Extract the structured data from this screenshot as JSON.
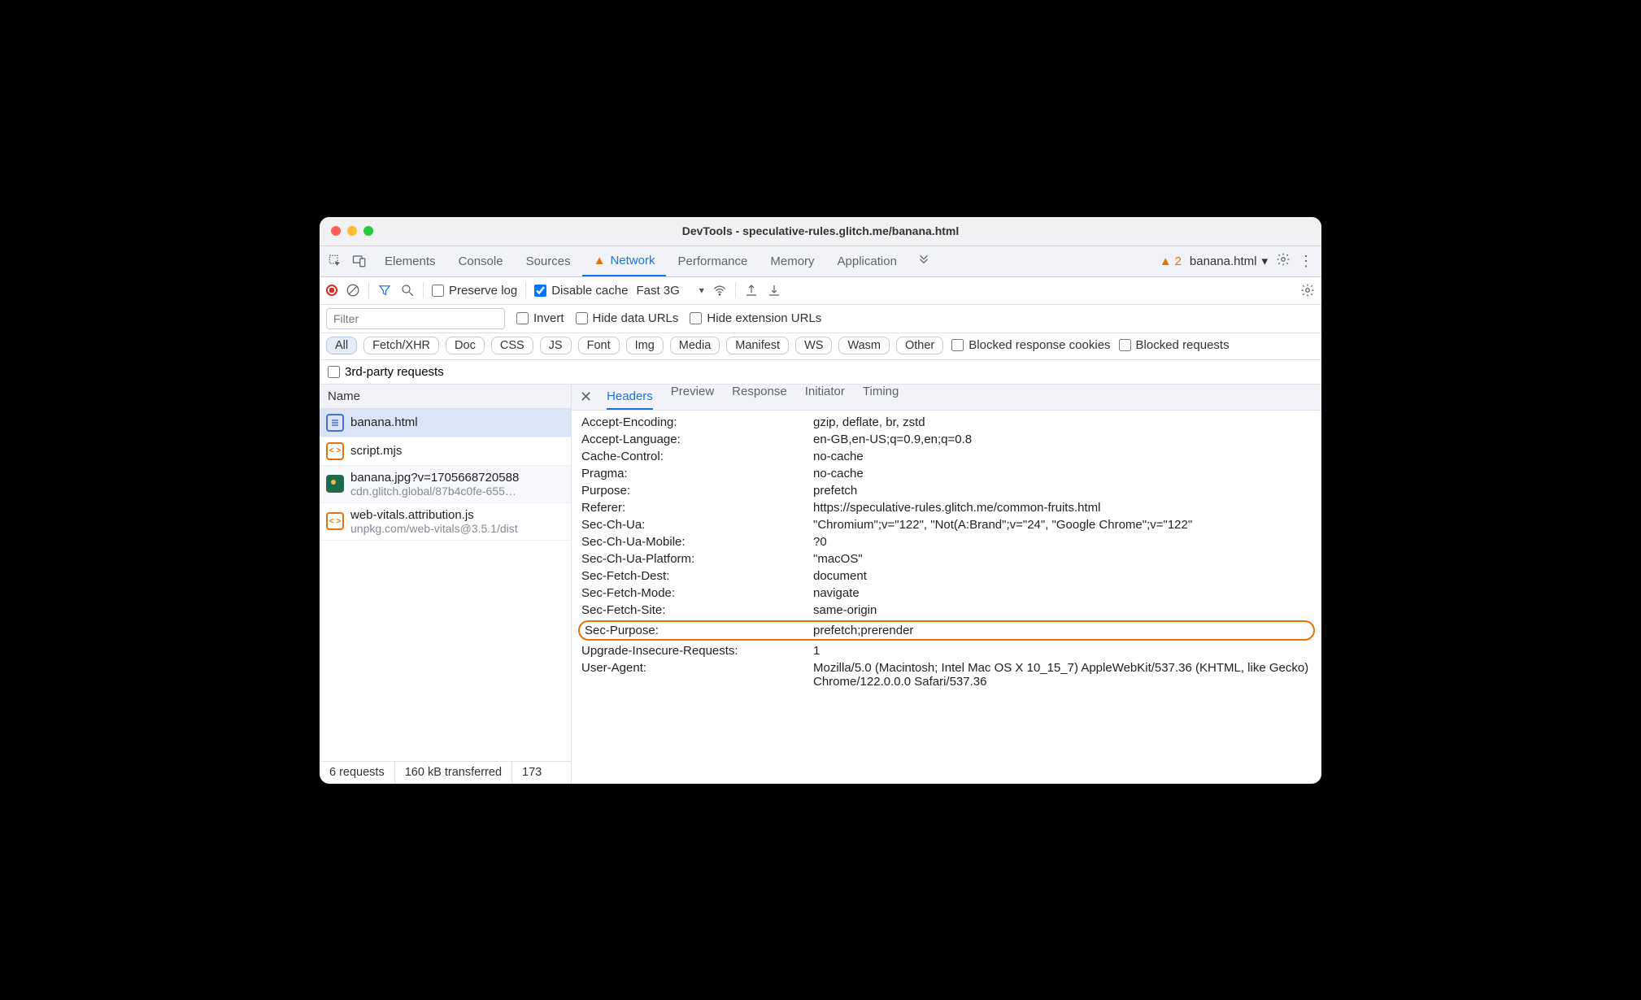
{
  "window_title": "DevTools - speculative-rules.glitch.me/banana.html",
  "tabs": [
    "Elements",
    "Console",
    "Sources",
    "Network",
    "Performance",
    "Memory",
    "Application"
  ],
  "active_tab": "Network",
  "warnings_count": "2",
  "context_target": "banana.html",
  "toolbar": {
    "preserve_log": "Preserve log",
    "disable_cache": "Disable cache",
    "throttling": "Fast 3G"
  },
  "filter": {
    "placeholder": "Filter",
    "invert": "Invert",
    "hide_data_urls": "Hide data URLs",
    "hide_extension_urls": "Hide extension URLs"
  },
  "type_filters": [
    "All",
    "Fetch/XHR",
    "Doc",
    "CSS",
    "JS",
    "Font",
    "Img",
    "Media",
    "Manifest",
    "WS",
    "Wasm",
    "Other"
  ],
  "blocked_cookies": "Blocked response cookies",
  "blocked_requests": "Blocked requests",
  "third_party": "3rd-party requests",
  "request_list_header": "Name",
  "requests": [
    {
      "name": "banana.html",
      "sub": "",
      "icon": "doc",
      "selected": true
    },
    {
      "name": "script.mjs",
      "sub": "",
      "icon": "js"
    },
    {
      "name": "banana.jpg?v=1705668720588",
      "sub": "cdn.glitch.global/87b4c0fe-655…",
      "icon": "img"
    },
    {
      "name": "web-vitals.attribution.js",
      "sub": "unpkg.com/web-vitals@3.5.1/dist",
      "icon": "js"
    }
  ],
  "detail_tabs": [
    "Headers",
    "Preview",
    "Response",
    "Initiator",
    "Timing"
  ],
  "headers": [
    {
      "k": "Accept-Encoding:",
      "v": "gzip, deflate, br, zstd"
    },
    {
      "k": "Accept-Language:",
      "v": "en-GB,en-US;q=0.9,en;q=0.8"
    },
    {
      "k": "Cache-Control:",
      "v": "no-cache"
    },
    {
      "k": "Pragma:",
      "v": "no-cache"
    },
    {
      "k": "Purpose:",
      "v": "prefetch"
    },
    {
      "k": "Referer:",
      "v": "https://speculative-rules.glitch.me/common-fruits.html"
    },
    {
      "k": "Sec-Ch-Ua:",
      "v": "\"Chromium\";v=\"122\", \"Not(A:Brand\";v=\"24\", \"Google Chrome\";v=\"122\""
    },
    {
      "k": "Sec-Ch-Ua-Mobile:",
      "v": "?0"
    },
    {
      "k": "Sec-Ch-Ua-Platform:",
      "v": "\"macOS\""
    },
    {
      "k": "Sec-Fetch-Dest:",
      "v": "document"
    },
    {
      "k": "Sec-Fetch-Mode:",
      "v": "navigate"
    },
    {
      "k": "Sec-Fetch-Site:",
      "v": "same-origin"
    },
    {
      "k": "Sec-Purpose:",
      "v": "prefetch;prerender",
      "highlight": true
    },
    {
      "k": "Upgrade-Insecure-Requests:",
      "v": "1"
    },
    {
      "k": "User-Agent:",
      "v": "Mozilla/5.0 (Macintosh; Intel Mac OS X 10_15_7) AppleWebKit/537.36 (KHTML, like Gecko) Chrome/122.0.0.0 Safari/537.36"
    }
  ],
  "status": {
    "requests": "6 requests",
    "transferred": "160 kB transferred",
    "resources_partial": "173"
  }
}
